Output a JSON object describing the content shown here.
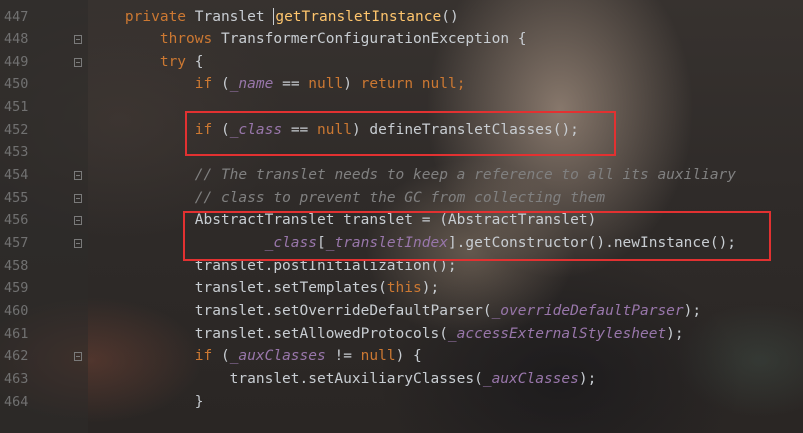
{
  "colors": {
    "keyword": "#cc7832",
    "method_decl": "#ffc66d",
    "field": "#9876aa",
    "comment": "#808080",
    "plain": "#c8cdd2",
    "line_number": "#717171",
    "highlight_box": "#e23131"
  },
  "editor": {
    "lines": [
      {
        "number": "447",
        "segments": [
          {
            "t": "    "
          },
          {
            "t": "private",
            "c": "kw"
          },
          {
            "t": " Translet "
          },
          {
            "t": "getTransletInstance",
            "c": "fn"
          },
          {
            "t": "()"
          }
        ],
        "caret_before": 3
      },
      {
        "number": "448",
        "segments": [
          {
            "t": "        "
          },
          {
            "t": "throws",
            "c": "kw"
          },
          {
            "t": " TransformerConfigurationException {"
          }
        ]
      },
      {
        "number": "449",
        "segments": [
          {
            "t": "        "
          },
          {
            "t": "try",
            "c": "kw"
          },
          {
            "t": " {"
          }
        ]
      },
      {
        "number": "450",
        "segments": [
          {
            "t": "            "
          },
          {
            "t": "if",
            "c": "kw"
          },
          {
            "t": " ("
          },
          {
            "t": "_name",
            "c": "fld"
          },
          {
            "t": " == "
          },
          {
            "t": "null",
            "c": "kw"
          },
          {
            "t": ") "
          },
          {
            "t": "return null",
            "c": "kw"
          },
          {
            "t": ";",
            "c": "kw"
          }
        ]
      },
      {
        "number": "451",
        "segments": []
      },
      {
        "number": "452",
        "segments": [
          {
            "t": "            "
          },
          {
            "t": "if",
            "c": "kw"
          },
          {
            "t": " ("
          },
          {
            "t": "_class",
            "c": "fld"
          },
          {
            "t": " == "
          },
          {
            "t": "null",
            "c": "kw"
          },
          {
            "t": ") defineTransletClasses();"
          }
        ]
      },
      {
        "number": "453",
        "segments": []
      },
      {
        "number": "454",
        "segments": [
          {
            "t": "            "
          },
          {
            "t": "// The translet needs to keep a reference to all its auxiliary",
            "c": "cmt"
          }
        ]
      },
      {
        "number": "455",
        "segments": [
          {
            "t": "            "
          },
          {
            "t": "// class to prevent the GC from collecting them",
            "c": "cmt"
          }
        ]
      },
      {
        "number": "456",
        "segments": [
          {
            "t": "            AbstractTranslet translet = (AbstractTranslet)"
          }
        ]
      },
      {
        "number": "457",
        "segments": [
          {
            "t": "                    "
          },
          {
            "t": "_class",
            "c": "fld"
          },
          {
            "t": "["
          },
          {
            "t": "_transletIndex",
            "c": "fld"
          },
          {
            "t": "].getConstructor().newInstance();"
          }
        ]
      },
      {
        "number": "458",
        "segments": [
          {
            "t": "            translet.postInitialization();"
          }
        ]
      },
      {
        "number": "459",
        "segments": [
          {
            "t": "            translet.setTemplates("
          },
          {
            "t": "this",
            "c": "kw"
          },
          {
            "t": ");"
          }
        ]
      },
      {
        "number": "460",
        "segments": [
          {
            "t": "            translet.setOverrideDefaultParser("
          },
          {
            "t": "_overrideDefaultParser",
            "c": "fld"
          },
          {
            "t": ");"
          }
        ]
      },
      {
        "number": "461",
        "segments": [
          {
            "t": "            translet.setAllowedProtocols("
          },
          {
            "t": "_accessExternalStylesheet",
            "c": "fld"
          },
          {
            "t": ");"
          }
        ]
      },
      {
        "number": "462",
        "segments": [
          {
            "t": "            "
          },
          {
            "t": "if",
            "c": "kw"
          },
          {
            "t": " ("
          },
          {
            "t": "_auxClasses",
            "c": "fld"
          },
          {
            "t": " != "
          },
          {
            "t": "null",
            "c": "kw"
          },
          {
            "t": ") {"
          }
        ]
      },
      {
        "number": "463",
        "segments": [
          {
            "t": "                translet.setAuxiliaryClasses("
          },
          {
            "t": "_auxClasses",
            "c": "fld"
          },
          {
            "t": ");"
          }
        ]
      },
      {
        "number": "464",
        "segments": [
          {
            "t": "            }"
          }
        ]
      }
    ],
    "fold_markers": [
      "448",
      "449",
      "454",
      "455",
      "456",
      "457",
      "462"
    ]
  },
  "highlights": [
    {
      "label": "define-translet-classes-highlight",
      "first_line": "452",
      "last_line": "452"
    },
    {
      "label": "new-instance-highlight",
      "first_line": "456",
      "last_line": "457"
    }
  ]
}
